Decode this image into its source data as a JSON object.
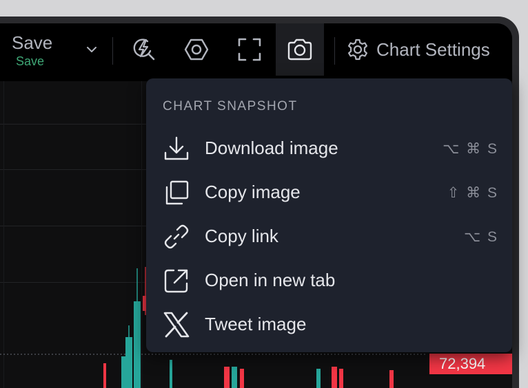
{
  "toolbar": {
    "save_label": "Save",
    "save_status": "Save",
    "settings_label": "Chart Settings",
    "icons": [
      "chevron-down-icon",
      "lightning-search-icon",
      "hexagon-icon",
      "fullscreen-icon",
      "camera-icon",
      "gear-icon"
    ]
  },
  "chart": {
    "last_price_label": "72,394"
  },
  "snapshot_menu": {
    "header": "CHART SNAPSHOT",
    "items": [
      {
        "label": "Download image",
        "shortcut": "⌥ ⌘ S",
        "icon": "download-icon"
      },
      {
        "label": "Copy image",
        "shortcut": "⇧ ⌘ S",
        "icon": "copy-icon"
      },
      {
        "label": "Copy link",
        "shortcut": "⌥ S",
        "icon": "link-icon"
      },
      {
        "label": "Open in new tab",
        "shortcut": "",
        "icon": "external-link-icon"
      },
      {
        "label": "Tweet image",
        "shortcut": "",
        "icon": "x-logo-icon"
      }
    ]
  },
  "colors": {
    "accent_green": "#3fa776",
    "candle_up": "#26a69a",
    "candle_down": "#f23645",
    "menu_bg": "#1e222d"
  }
}
